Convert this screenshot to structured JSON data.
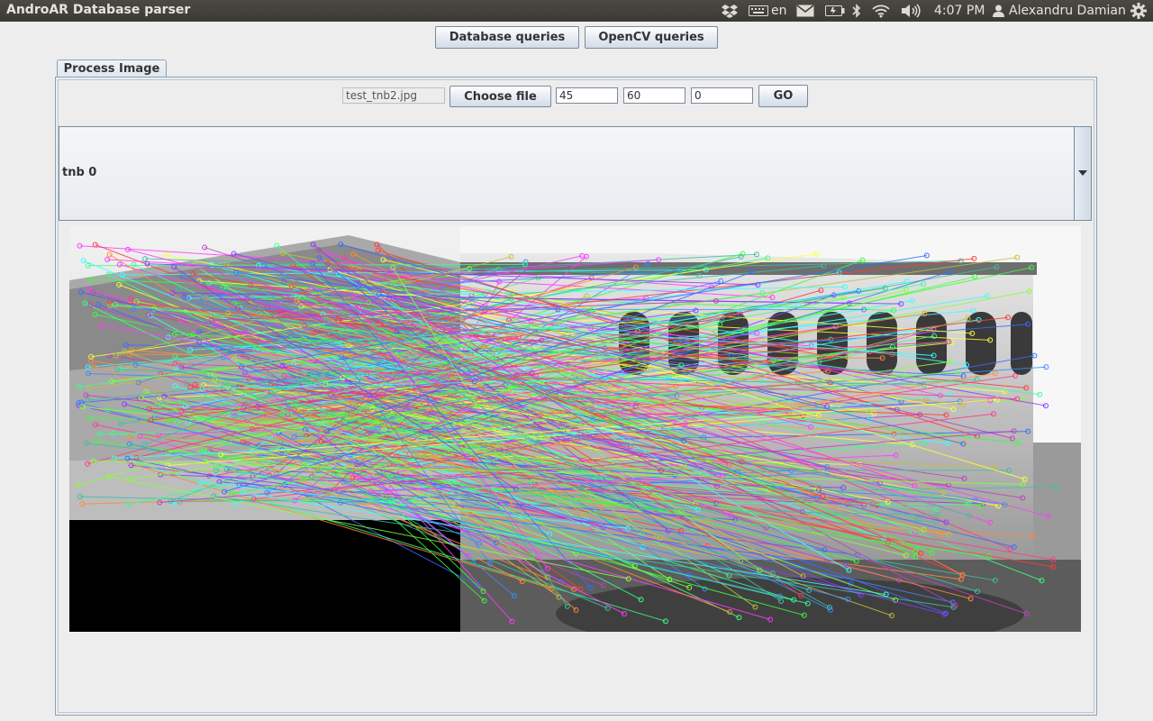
{
  "top_panel": {
    "app_title": "AndroAR Database parser",
    "keyboard_layout": "en",
    "clock": "4:07 PM",
    "user_name": "Alexandru Damian",
    "icons": [
      "dropbox-icon",
      "keyboard-icon",
      "mail-icon",
      "battery-icon",
      "bluetooth-icon",
      "wifi-icon",
      "volume-icon",
      "user-icon",
      "gear-icon"
    ]
  },
  "toolbar": {
    "database_queries_label": "Database queries",
    "opencv_queries_label": "OpenCV queries"
  },
  "tabs": [
    {
      "label": "Process Image",
      "selected": true
    }
  ],
  "process_image": {
    "file_name": "test_tnb2.jpg",
    "choose_file_label": "Choose file",
    "param1": "45",
    "param2": "60",
    "param3": "0",
    "go_label": "GO",
    "result_combo_selected": "tnb 0"
  },
  "colors": {
    "panel_bg": "#ededed",
    "top_bar": "#3c3b37",
    "border": "#8da2b5"
  }
}
